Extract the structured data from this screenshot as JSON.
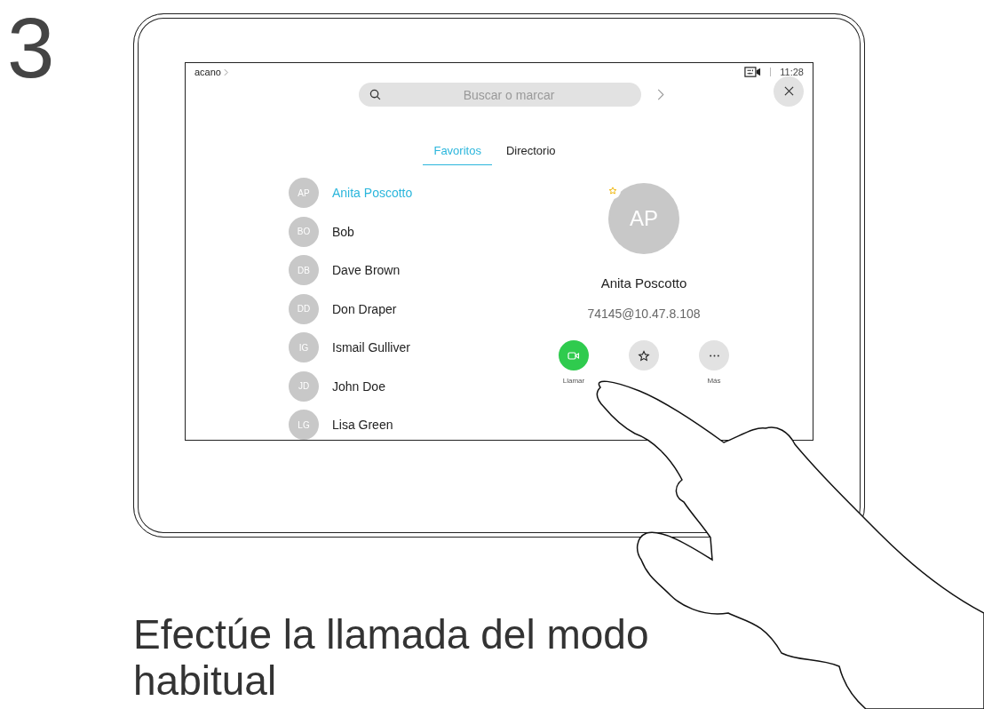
{
  "step_number": "3",
  "screen": {
    "brand": "acano",
    "time": "11:28",
    "search": {
      "placeholder": "Buscar o marcar"
    },
    "tabs": [
      {
        "label": "Favoritos",
        "selected": true
      },
      {
        "label": "Directorio",
        "selected": false
      }
    ],
    "contacts": [
      {
        "initials": "AP",
        "name": "Anita Poscotto",
        "selected": true
      },
      {
        "initials": "BO",
        "name": "Bob",
        "selected": false
      },
      {
        "initials": "DB",
        "name": "Dave Brown",
        "selected": false
      },
      {
        "initials": "DD",
        "name": "Don Draper",
        "selected": false
      },
      {
        "initials": "IG",
        "name": "Ismail Gulliver",
        "selected": false
      },
      {
        "initials": "JD",
        "name": "John Doe",
        "selected": false
      },
      {
        "initials": "LG",
        "name": "Lisa Green",
        "selected": false
      }
    ],
    "detail": {
      "initials": "AP",
      "favorite": true,
      "name": "Anita Poscotto",
      "address": "74145@10.47.8.108",
      "actions": [
        {
          "kind": "call",
          "label": "Llamar"
        },
        {
          "kind": "favorite"
        },
        {
          "kind": "more",
          "label": "Más"
        }
      ]
    }
  },
  "caption": "Efectúe la llamada del modo habitual"
}
